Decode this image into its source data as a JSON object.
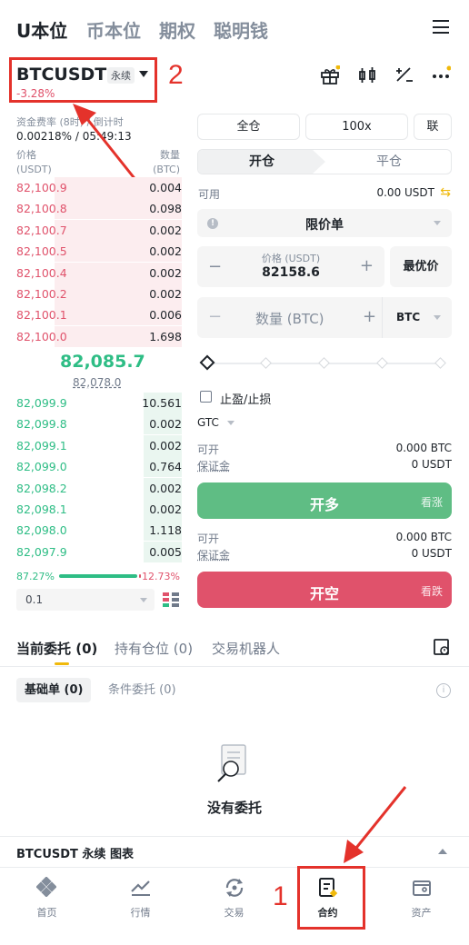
{
  "top_tabs": [
    "U本位",
    "币本位",
    "期权",
    "聪明钱"
  ],
  "symbol": {
    "name": "BTCUSDT",
    "badge": "永续",
    "change": "-3.28%"
  },
  "annotations": {
    "box1_number": "1",
    "box2_number": "2",
    "color": "#e4322b"
  },
  "funding": {
    "label": "资金费率 (8时) / 倒计时",
    "value": "0.00218% / 05:49:13"
  },
  "orderbook": {
    "price_header": "价格",
    "price_unit": "(USDT)",
    "qty_header": "数量",
    "qty_unit": "(BTC)",
    "asks": [
      {
        "price": "82,100.9",
        "qty": "0.004",
        "depth": 0.7
      },
      {
        "price": "82,100.8",
        "qty": "0.098",
        "depth": 0.7
      },
      {
        "price": "82,100.7",
        "qty": "0.002",
        "depth": 0.7
      },
      {
        "price": "82,100.5",
        "qty": "0.002",
        "depth": 0.7
      },
      {
        "price": "82,100.4",
        "qty": "0.002",
        "depth": 0.7
      },
      {
        "price": "82,100.2",
        "qty": "0.002",
        "depth": 0.7
      },
      {
        "price": "82,100.1",
        "qty": "0.006",
        "depth": 0.7
      },
      {
        "price": "82,100.0",
        "qty": "1.698",
        "depth": 0.7
      }
    ],
    "last_price": "82,085.7",
    "mark_price": "82,078.0",
    "bids": [
      {
        "price": "82,099.9",
        "qty": "10.561",
        "depth": 0.21
      },
      {
        "price": "82,099.8",
        "qty": "0.002",
        "depth": 0.21
      },
      {
        "price": "82,099.1",
        "qty": "0.002",
        "depth": 0.21
      },
      {
        "price": "82,099.0",
        "qty": "0.764",
        "depth": 0.21
      },
      {
        "price": "82,098.2",
        "qty": "0.002",
        "depth": 0.21
      },
      {
        "price": "82,098.1",
        "qty": "0.002",
        "depth": 0.21
      },
      {
        "price": "82,098.0",
        "qty": "1.118",
        "depth": 0.21
      },
      {
        "price": "82,097.9",
        "qty": "0.005",
        "depth": 0.21
      }
    ],
    "buy_ratio": "87.27%",
    "sell_ratio": "12.73%",
    "depth_precision": "0.1"
  },
  "trade_panel": {
    "margin_mode": "全仓",
    "leverage": "100x",
    "asset_mode": "联",
    "open_tab": "开仓",
    "close_tab": "平仓",
    "available_label": "可用",
    "available_value": "0.00 USDT",
    "order_type": "限价单",
    "price_label": "价格 (USDT)",
    "price_value": "82158.6",
    "best_price_btn": "最优价",
    "qty_placeholder": "数量 (BTC)",
    "qty_unit": "BTC",
    "tpsl_label": "止盈/止损",
    "tif": "GTC",
    "long": {
      "open_label": "可开",
      "open_value": "0.000 BTC",
      "margin_label": "保证金",
      "margin_value": "0 USDT",
      "button": "开多",
      "button_sub": "看涨"
    },
    "short": {
      "open_label": "可开",
      "open_value": "0.000 BTC",
      "margin_label": "保证金",
      "margin_value": "0 USDT",
      "button": "开空",
      "button_sub": "看跌"
    },
    "colors": {
      "long": "#5fbd84",
      "short": "#e0526b",
      "accent": "#f0b90b"
    }
  },
  "orders": {
    "tabs": [
      {
        "label": "当前委托",
        "count": "(0)"
      },
      {
        "label": "持有仓位",
        "count": "(0)"
      },
      {
        "label": "交易机器人",
        "count": ""
      }
    ],
    "sub_tabs": [
      {
        "label": "基础单",
        "count": "(0)"
      },
      {
        "label": "条件委托",
        "count": "(0)"
      }
    ],
    "empty_text": "没有委托"
  },
  "chart_bar_label": "BTCUSDT 永续 图表",
  "nav": [
    {
      "label": "首页",
      "icon": "home-icon"
    },
    {
      "label": "行情",
      "icon": "markets-icon"
    },
    {
      "label": "交易",
      "icon": "trade-icon"
    },
    {
      "label": "合约",
      "icon": "futures-icon"
    },
    {
      "label": "资产",
      "icon": "wallet-icon"
    }
  ]
}
